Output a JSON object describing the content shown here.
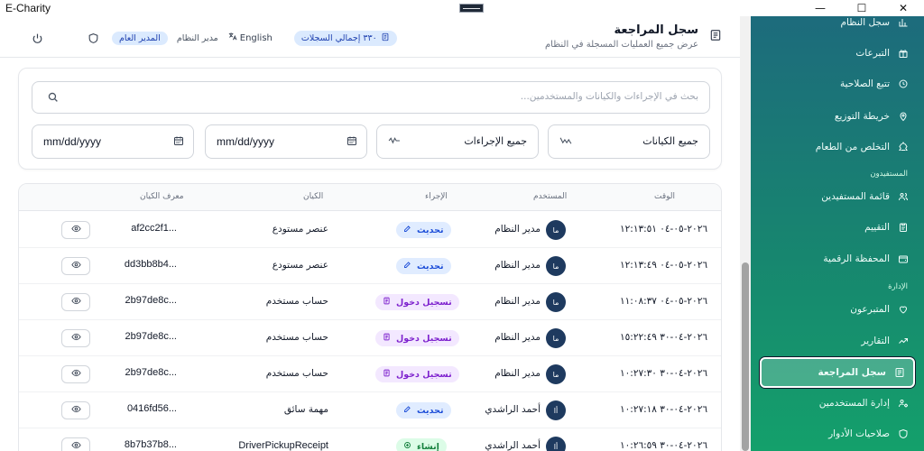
{
  "window": {
    "title": "E-Charity",
    "controls": [
      "—",
      "☐",
      "✕"
    ]
  },
  "header": {
    "title": "سجل المراجعة",
    "subtitle": "عرض جميع العمليات المسجلة في النظام",
    "role_pill": "المدير العام",
    "role_text": "مدير النظام",
    "language": "English",
    "records_count": "٣٣٠ إجمالي السجلات"
  },
  "filters": {
    "search_placeholder": "بحث في الإجراءات والكيانات والمستخدمين...",
    "entities_select": "جميع الكيانات",
    "actions_select": "جميع الإجراءات",
    "date_from": "mm/dd/yyyy",
    "date_to": "mm/dd/yyyy"
  },
  "table": {
    "columns": {
      "time": "الوقت",
      "user": "المستخدم",
      "action": "الإجراء",
      "entity": "الكيان",
      "entity_id": "معرف الكيان"
    },
    "rows": [
      {
        "time": "٢٠٢٦-٠٥-٠٤ ١٢:١٣:٥١",
        "initials": "ما",
        "user": "مدير النظام",
        "action": "تحديث",
        "action_type": "update",
        "entity": "عنصر مستودع",
        "entity_id": "af2cc2f1..."
      },
      {
        "time": "٢٠٢٦-٠٥-٠٤ ١٢:١٣:٤٩",
        "initials": "ما",
        "user": "مدير النظام",
        "action": "تحديث",
        "action_type": "update",
        "entity": "عنصر مستودع",
        "entity_id": "dd3bb8b4..."
      },
      {
        "time": "٢٠٢٦-٠٥-٠٤ ١١:٠٨:٣٧",
        "initials": "ما",
        "user": "مدير النظام",
        "action": "تسجيل دخول",
        "action_type": "login",
        "entity": "حساب مستخدم",
        "entity_id": "2b97de8c..."
      },
      {
        "time": "٢٠٢٦-٠٤-٣٠ ١٥:٢٢:٤٩",
        "initials": "ما",
        "user": "مدير النظام",
        "action": "تسجيل دخول",
        "action_type": "login",
        "entity": "حساب مستخدم",
        "entity_id": "2b97de8c..."
      },
      {
        "time": "٢٠٢٦-٠٤-٣٠ ١٠:٢٧:٣٠",
        "initials": "ما",
        "user": "مدير النظام",
        "action": "تسجيل دخول",
        "action_type": "login",
        "entity": "حساب مستخدم",
        "entity_id": "2b97de8c..."
      },
      {
        "time": "٢٠٢٦-٠٤-٣٠ ١٠:٢٧:١٨",
        "initials": "أا",
        "user": "أحمد الراشدي",
        "action": "تحديث",
        "action_type": "update",
        "entity": "مهمة سائق",
        "entity_id": "0416fd56..."
      },
      {
        "time": "٢٠٢٦-٠٤-٣٠ ١٠:٢٦:٥٩",
        "initials": "أا",
        "user": "أحمد الراشدي",
        "action": "إنشاء",
        "action_type": "create",
        "entity": "DriverPickupReceipt",
        "entity_id": "8b7b37b8..."
      }
    ]
  },
  "sidebar": {
    "items_top": [
      {
        "label": "سجل النظام",
        "icon": "chart-icon"
      },
      {
        "label": "التبرعات",
        "icon": "gift-icon"
      },
      {
        "label": "تتبع الصلاحية",
        "icon": "clock-icon"
      },
      {
        "label": "خريطة التوزيع",
        "icon": "map-pin-icon"
      },
      {
        "label": "التخلص من الطعام",
        "icon": "recycle-icon"
      }
    ],
    "section_beneficiaries": "المستفيدون",
    "items_beneficiaries": [
      {
        "label": "قائمة المستفيدين",
        "icon": "users-icon"
      },
      {
        "label": "التقييم",
        "icon": "clipboard-icon"
      },
      {
        "label": "المحفظة الرقمية",
        "icon": "wallet-icon"
      }
    ],
    "section_admin": "الإدارة",
    "items_admin": [
      {
        "label": "المتبرعون",
        "icon": "heart-icon"
      },
      {
        "label": "التقارير",
        "icon": "trend-icon"
      },
      {
        "label": "سجل المراجعة",
        "icon": "log-icon",
        "active": true
      },
      {
        "label": "إدارة المستخدمين",
        "icon": "user-gear-icon"
      },
      {
        "label": "صلاحيات الأدوار",
        "icon": "shield-icon"
      }
    ]
  },
  "colors": {
    "accent": "#1d4ed8",
    "sidebar_top": "#1d6b7c",
    "sidebar_bottom": "#14a06b",
    "avatar": "#1e3a5f"
  }
}
